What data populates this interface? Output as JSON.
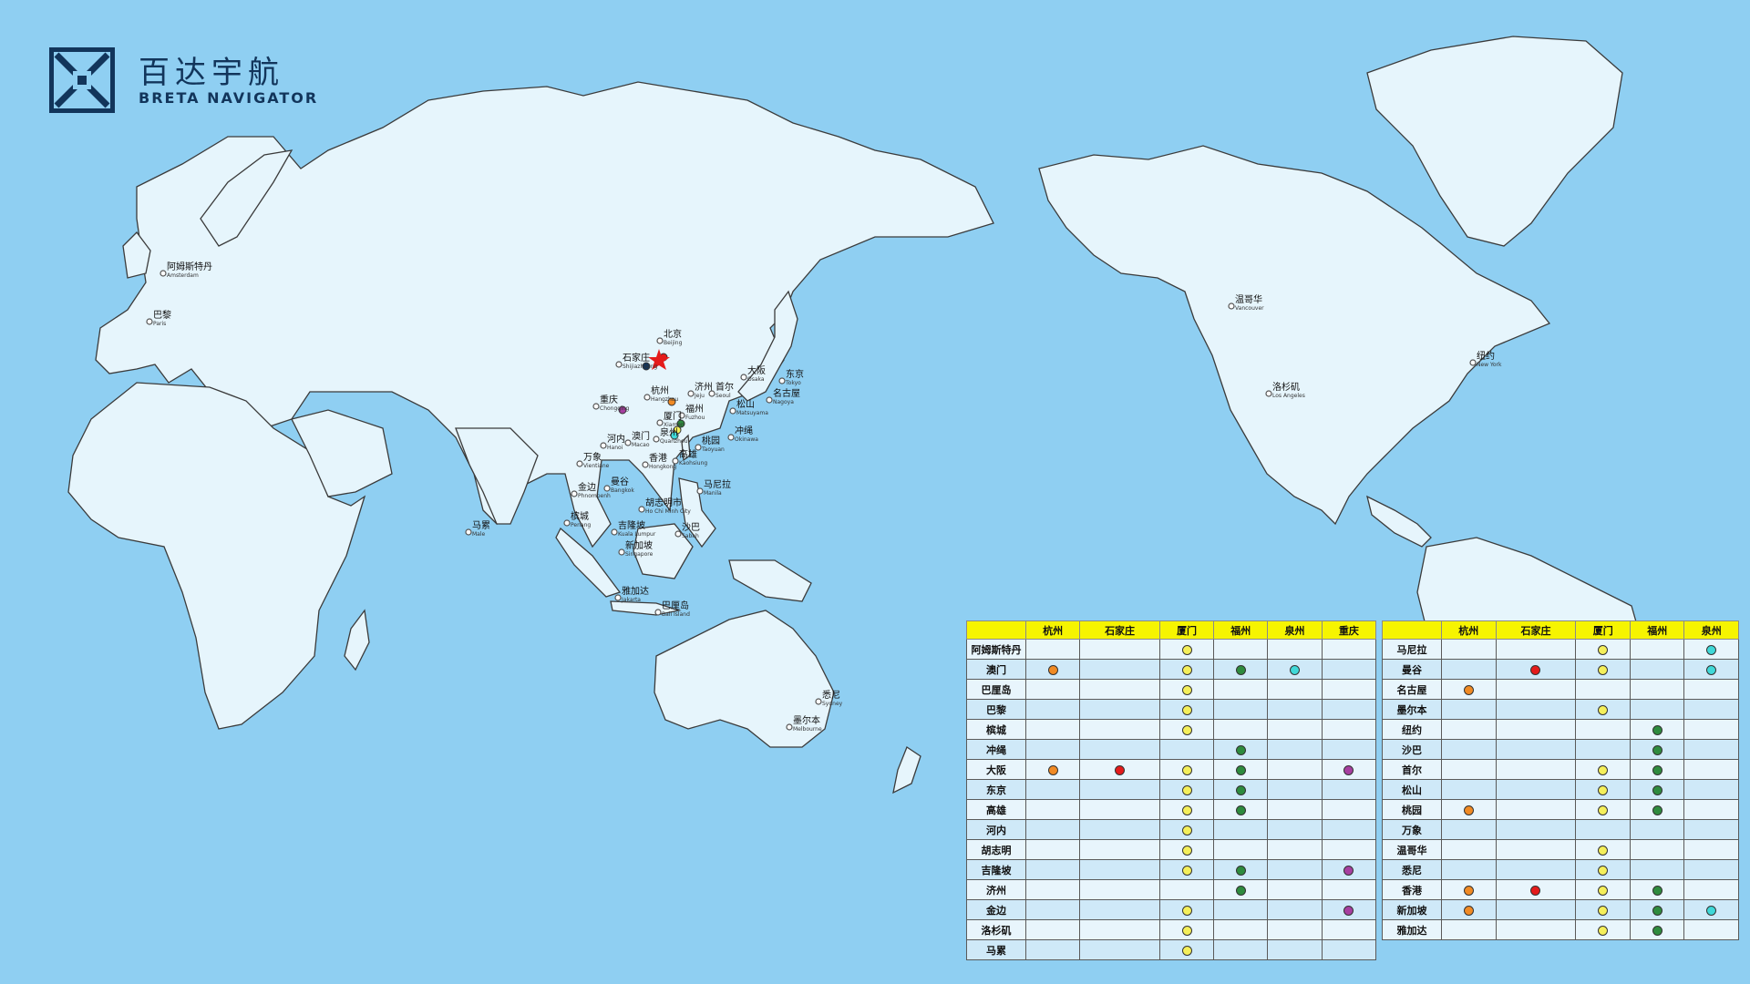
{
  "logo": {
    "name_zh": "百达宇航",
    "name_en": "BRETA NAVIGATOR"
  },
  "colors": {
    "杭州": "#f08a24",
    "石家庄": "#e41b1b",
    "厦门": "#f4ef5a",
    "福州": "#2e8b3e",
    "泉州": "#3fd8d8",
    "重庆": "#a63fa0",
    "ocean": "#8fcff2",
    "land": "#e6f5fc"
  },
  "cities": [
    {
      "zh": "阿姆斯特丹",
      "en": "Amsterdam"
    },
    {
      "zh": "巴黎",
      "en": "Paris"
    },
    {
      "zh": "北京",
      "en": "Beijing"
    },
    {
      "zh": "石家庄",
      "en": "Shijiazhuang"
    },
    {
      "zh": "重庆",
      "en": "Chongqing"
    },
    {
      "zh": "杭州",
      "en": "Hangzhou"
    },
    {
      "zh": "济州",
      "en": "Jeju"
    },
    {
      "zh": "首尔",
      "en": "Seoul"
    },
    {
      "zh": "大阪",
      "en": "Osaka"
    },
    {
      "zh": "东京",
      "en": "Tokyo"
    },
    {
      "zh": "名古屋",
      "en": "Nagoya"
    },
    {
      "zh": "松山",
      "en": "Matsuyama"
    },
    {
      "zh": "福州",
      "en": "Fuzhou"
    },
    {
      "zh": "厦门",
      "en": "Xiamen"
    },
    {
      "zh": "泉州",
      "en": "Quanzhou"
    },
    {
      "zh": "冲绳",
      "en": "Okinawa"
    },
    {
      "zh": "桃园",
      "en": "Taoyuan"
    },
    {
      "zh": "河内",
      "en": "Hanoi"
    },
    {
      "zh": "澳门",
      "en": "Macao"
    },
    {
      "zh": "万象",
      "en": "Vientiane"
    },
    {
      "zh": "香港",
      "en": "Hongkong"
    },
    {
      "zh": "高雄",
      "en": "Kaohsiung"
    },
    {
      "zh": "曼谷",
      "en": "Bangkok"
    },
    {
      "zh": "金边",
      "en": "Phnompenh"
    },
    {
      "zh": "马尼拉",
      "en": "Manila"
    },
    {
      "zh": "胡志明市",
      "en": "Ho Chi Minh City"
    },
    {
      "zh": "槟城",
      "en": "Penang"
    },
    {
      "zh": "吉隆坡",
      "en": "Kuala Lumpur"
    },
    {
      "zh": "沙巴",
      "en": "Sabah"
    },
    {
      "zh": "新加坡",
      "en": "Singapore"
    },
    {
      "zh": "马累",
      "en": "Male"
    },
    {
      "zh": "雅加达",
      "en": "Jakarta"
    },
    {
      "zh": "巴厘岛",
      "en": "Bali Island"
    },
    {
      "zh": "悉尼",
      "en": "Sydney"
    },
    {
      "zh": "墨尔本",
      "en": "Melbourne"
    },
    {
      "zh": "温哥华",
      "en": "Vancouver"
    },
    {
      "zh": "洛杉矶",
      "en": "Los Angeles"
    },
    {
      "zh": "纽约",
      "en": "New York"
    }
  ],
  "tables": [
    {
      "id": "A",
      "headers": [
        "杭州",
        "石家庄",
        "厦门",
        "福州",
        "泉州",
        "重庆"
      ],
      "rows": [
        {
          "city": "阿姆斯特丹",
          "marks": [
            "",
            "",
            "厦门",
            "",
            "",
            ""
          ]
        },
        {
          "city": "澳门",
          "marks": [
            "杭州",
            "",
            "厦门",
            "福州",
            "泉州",
            ""
          ]
        },
        {
          "city": "巴厘岛",
          "marks": [
            "",
            "",
            "厦门",
            "",
            "",
            ""
          ]
        },
        {
          "city": "巴黎",
          "marks": [
            "",
            "",
            "厦门",
            "",
            "",
            ""
          ]
        },
        {
          "city": "槟城",
          "marks": [
            "",
            "",
            "厦门",
            "",
            "",
            ""
          ]
        },
        {
          "city": "冲绳",
          "marks": [
            "",
            "",
            "",
            "福州",
            "",
            ""
          ]
        },
        {
          "city": "大阪",
          "marks": [
            "杭州",
            "石家庄",
            "厦门",
            "福州",
            "",
            "重庆"
          ]
        },
        {
          "city": "东京",
          "marks": [
            "",
            "",
            "厦门",
            "福州",
            "",
            ""
          ]
        },
        {
          "city": "高雄",
          "marks": [
            "",
            "",
            "厦门",
            "福州",
            "",
            ""
          ]
        },
        {
          "city": "河内",
          "marks": [
            "",
            "",
            "厦门",
            "",
            "",
            ""
          ]
        },
        {
          "city": "胡志明",
          "marks": [
            "",
            "",
            "厦门",
            "",
            "",
            ""
          ]
        },
        {
          "city": "吉隆坡",
          "marks": [
            "",
            "",
            "厦门",
            "福州",
            "",
            "重庆"
          ]
        },
        {
          "city": "济州",
          "marks": [
            "",
            "",
            "",
            "福州",
            "",
            ""
          ]
        },
        {
          "city": "金边",
          "marks": [
            "",
            "",
            "厦门",
            "",
            "",
            "重庆"
          ]
        },
        {
          "city": "洛杉矶",
          "marks": [
            "",
            "",
            "厦门",
            "",
            "",
            ""
          ]
        },
        {
          "city": "马累",
          "marks": [
            "",
            "",
            "厦门",
            "",
            "",
            ""
          ]
        }
      ]
    },
    {
      "id": "B",
      "headers": [
        "杭州",
        "石家庄",
        "厦门",
        "福州",
        "泉州"
      ],
      "rows": [
        {
          "city": "马尼拉",
          "marks": [
            "",
            "",
            "厦门",
            "",
            "泉州"
          ]
        },
        {
          "city": "曼谷",
          "marks": [
            "",
            "石家庄",
            "厦门",
            "",
            "泉州"
          ]
        },
        {
          "city": "名古屋",
          "marks": [
            "杭州",
            "",
            "",
            "",
            ""
          ]
        },
        {
          "city": "墨尔本",
          "marks": [
            "",
            "",
            "厦门",
            "",
            ""
          ]
        },
        {
          "city": "纽约",
          "marks": [
            "",
            "",
            "",
            "福州",
            ""
          ]
        },
        {
          "city": "沙巴",
          "marks": [
            "",
            "",
            "",
            "福州",
            ""
          ]
        },
        {
          "city": "首尔",
          "marks": [
            "",
            "",
            "厦门",
            "福州",
            ""
          ]
        },
        {
          "city": "松山",
          "marks": [
            "",
            "",
            "厦门",
            "福州",
            ""
          ]
        },
        {
          "city": "桃园",
          "marks": [
            "杭州",
            "",
            "厦门",
            "福州",
            ""
          ]
        },
        {
          "city": "万象",
          "marks": [
            "",
            "",
            "",
            "",
            ""
          ]
        },
        {
          "city": "温哥华",
          "marks": [
            "",
            "",
            "厦门",
            "",
            ""
          ]
        },
        {
          "city": "悉尼",
          "marks": [
            "",
            "",
            "厦门",
            "",
            ""
          ]
        },
        {
          "city": "香港",
          "marks": [
            "杭州",
            "石家庄",
            "厦门",
            "福州",
            ""
          ]
        },
        {
          "city": "新加坡",
          "marks": [
            "杭州",
            "",
            "厦门",
            "福州",
            "泉州"
          ]
        },
        {
          "city": "雅加达",
          "marks": [
            "",
            "",
            "厦门",
            "福州",
            ""
          ]
        }
      ]
    }
  ]
}
